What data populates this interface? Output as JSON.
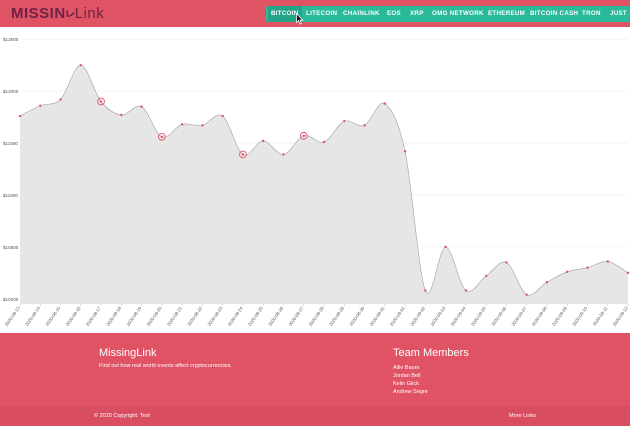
{
  "header": {
    "brand_main": "MISSIN",
    "brand_link": "Link",
    "nav": [
      {
        "label": "BITCOIN",
        "active": true
      },
      {
        "label": "LITECOIN",
        "active": false
      },
      {
        "label": "CHAINLINK",
        "active": false
      },
      {
        "label": "EOS",
        "active": false
      },
      {
        "label": "XRP",
        "active": false
      },
      {
        "label": "OMG NETWORK",
        "active": false
      },
      {
        "label": "ETHEREUM",
        "active": false
      },
      {
        "label": "BITCOIN CASH",
        "active": false
      },
      {
        "label": "TRON",
        "active": false
      },
      {
        "label": "JUST",
        "active": false
      }
    ]
  },
  "colors": {
    "header_bg": "#e05365",
    "nav_bg": "#2ab99a",
    "brand": "#6e2346",
    "area_fill": "#e6e6e6",
    "area_stroke": "#a0a0a0",
    "point": "#e05365"
  },
  "chart_data": {
    "type": "area",
    "x": [
      "2020-08-13",
      "2020-08-14",
      "2020-08-15",
      "2020-08-16",
      "2020-08-17",
      "2020-08-18",
      "2020-08-19",
      "2020-08-20",
      "2020-08-21",
      "2020-08-22",
      "2020-08-23",
      "2020-08-24",
      "2020-08-25",
      "2020-08-26",
      "2020-08-27",
      "2020-08-28",
      "2020-08-29",
      "2020-08-30",
      "2020-08-31",
      "2020-09-01",
      "2020-09-02",
      "2020-09-03",
      "2020-09-04",
      "2020-09-05",
      "2020-09-06",
      "2020-09-07",
      "2020-09-08",
      "2020-09-09",
      "2020-09-10",
      "2020-09-11",
      "2020-09-12"
    ],
    "values": [
      11760,
      11860,
      11920,
      12250,
      11900,
      11770,
      11850,
      11560,
      11680,
      11670,
      11760,
      11390,
      11520,
      11390,
      11570,
      11510,
      11710,
      11670,
      11880,
      11420,
      10080,
      10500,
      10080,
      10220,
      10350,
      10040,
      10160,
      10260,
      10300,
      10360,
      10250
    ],
    "highlighted_indices": [
      4,
      7,
      11,
      14
    ],
    "y_ticks": [
      "$10000",
      "$10500",
      "$11000",
      "$11500",
      "$12000",
      "$12500"
    ],
    "ylim": [
      9950,
      12550
    ],
    "grid": true
  },
  "footer": {
    "title": "MissingLink",
    "description": "Find out how real world events affect cryptocurrencies.",
    "team_title": "Team Members",
    "team": [
      "Allie Bauer",
      "Jordan Bell",
      "Kelin Glick",
      "Andrew Segre"
    ],
    "copyright": "© 2020 Copyright: Test",
    "more_links": "More Links"
  }
}
